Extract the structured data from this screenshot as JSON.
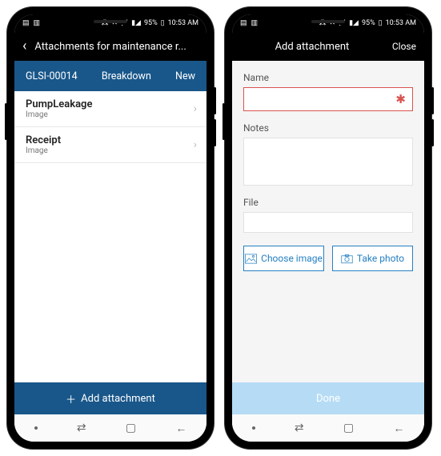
{
  "statusbar": {
    "signal_pct": "95%",
    "time": "10:53 AM"
  },
  "left_phone": {
    "header_title": "Attachments for maintenance r...",
    "info": {
      "id": "GLSI-00014",
      "type": "Breakdown",
      "status": "New"
    },
    "items": [
      {
        "name": "PumpLeakage",
        "sub": "Image"
      },
      {
        "name": "Receipt",
        "sub": "Image"
      }
    ],
    "add_label": "Add attachment"
  },
  "right_phone": {
    "header_title": "Add attachment",
    "close_label": "Close",
    "labels": {
      "name": "Name",
      "notes": "Notes",
      "file": "File"
    },
    "buttons": {
      "choose": "Choose image",
      "photo": "Take photo",
      "done": "Done"
    }
  }
}
